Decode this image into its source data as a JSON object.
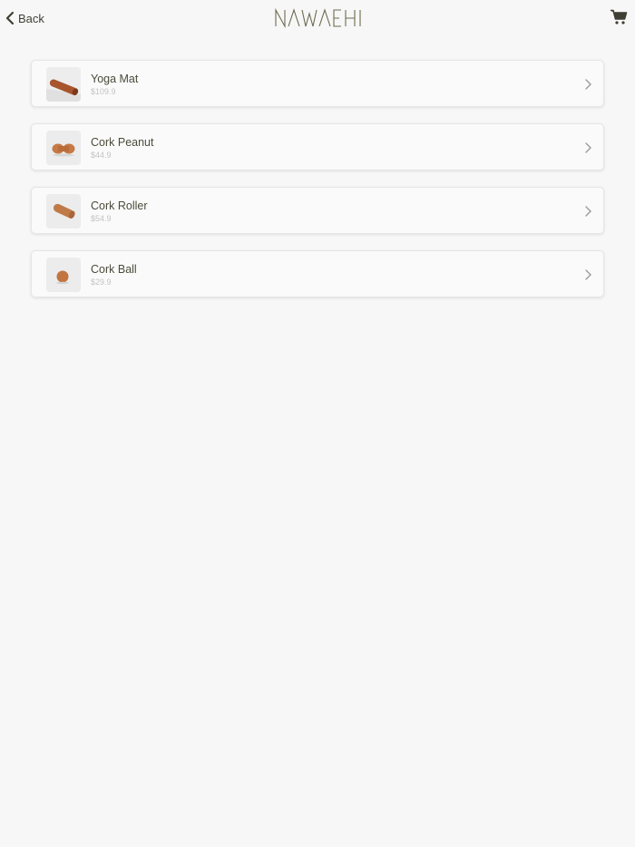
{
  "header": {
    "back_label": "Back",
    "logo_text": "NAWAEHI",
    "cart_icon": "cart-icon",
    "back_icon": "chevron-left-icon"
  },
  "colors": {
    "background": "#f7f7f7",
    "accent": "#6b6b4f",
    "text": "#4b4b3b",
    "price": "#c3c3c3"
  },
  "products": [
    {
      "name": "Yoga Mat",
      "price": "$109.9",
      "image": "yoga-mat-roll"
    },
    {
      "name": "Cork Peanut",
      "price": "$44.9",
      "image": "cork-peanut"
    },
    {
      "name": "Cork Roller",
      "price": "$54.9",
      "image": "cork-roller"
    },
    {
      "name": "Cork Ball",
      "price": "$29.9",
      "image": "cork-ball"
    }
  ]
}
